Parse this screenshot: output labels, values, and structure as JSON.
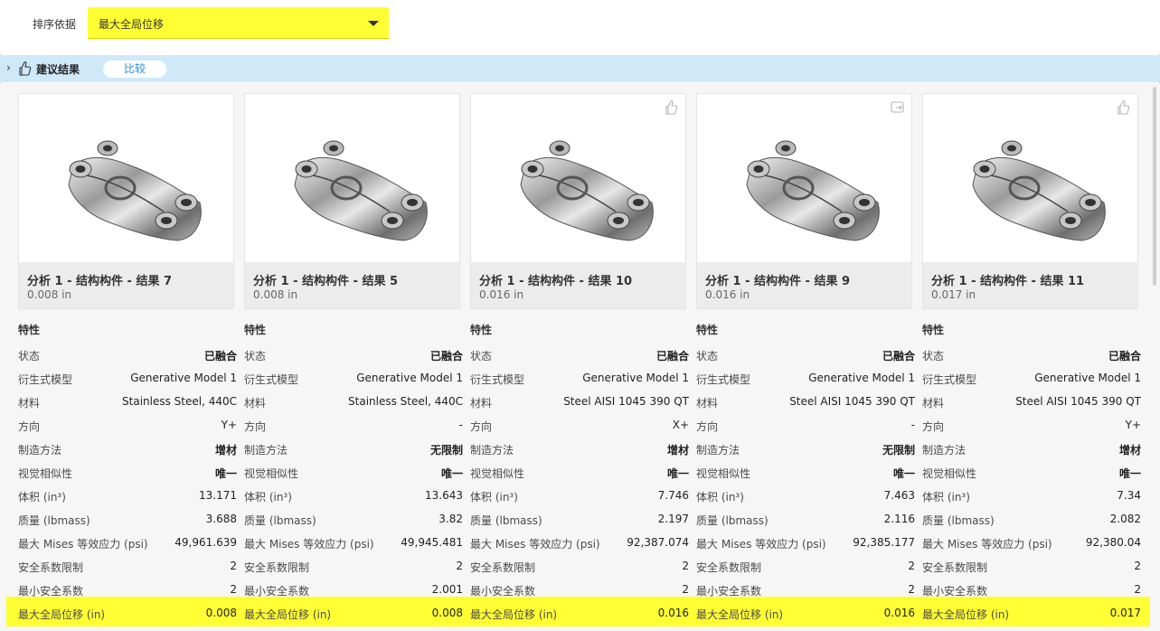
{
  "sort": {
    "label": "排序依据",
    "selected": "最大全局位移"
  },
  "results_bar": {
    "label": "建议结果",
    "compare_button": "比较"
  },
  "cards": [
    {
      "title": "分析 1 - 结构构件 - 结果 7",
      "value": "0.008 in",
      "corner_icon": ""
    },
    {
      "title": "分析 1 - 结构构件 - 结果 5",
      "value": "0.008 in",
      "corner_icon": ""
    },
    {
      "title": "分析 1 - 结构构件 - 结果 10",
      "value": "0.016 in",
      "corner_icon": "thumbs-up-icon"
    },
    {
      "title": "分析 1 - 结构构件 - 结果 9",
      "value": "0.016 in",
      "corner_icon": "export-icon"
    },
    {
      "title": "分析 1 - 结构构件 - 结果 11",
      "value": "0.017 in",
      "corner_icon": "thumbs-up-icon"
    }
  ],
  "properties": {
    "heading": "特性",
    "labels": [
      "状态",
      "衍生式模型",
      "材料",
      "方向",
      "制造方法",
      "视觉相似性",
      "体积 (in³)",
      "质量 (lbmass)",
      "最大 Mises 等效应力 (psi)",
      "安全系数限制",
      "最小安全系数",
      "最大全局位移 (in)"
    ],
    "columns": [
      [
        "已融合",
        "Generative Model 1",
        "Stainless Steel, 440C",
        "Y+",
        "增材",
        "唯一",
        "13.171",
        "3.688",
        "49,961.639",
        "2",
        "2",
        "0.008"
      ],
      [
        "已融合",
        "Generative Model 1",
        "Stainless Steel, 440C",
        "-",
        "无限制",
        "唯一",
        "13.643",
        "3.82",
        "49,945.481",
        "2",
        "2.001",
        "0.008"
      ],
      [
        "已融合",
        "Generative Model 1",
        "Steel AISI 1045 390 QT",
        "X+",
        "增材",
        "唯一",
        "7.746",
        "2.197",
        "92,387.074",
        "2",
        "2",
        "0.016"
      ],
      [
        "已融合",
        "Generative Model 1",
        "Steel AISI 1045 390 QT",
        "-",
        "无限制",
        "唯一",
        "7.463",
        "2.116",
        "92,385.177",
        "2",
        "2",
        "0.016"
      ],
      [
        "已融合",
        "Generative Model 1",
        "Steel AISI 1045 390 QT",
        "Y+",
        "增材",
        "唯一",
        "7.34",
        "2.082",
        "92,380.04",
        "2",
        "2",
        "0.017"
      ]
    ]
  },
  "colors": {
    "highlight": "#ffff33",
    "bar": "#cfe9f9",
    "accent": "#2a8fd6"
  }
}
